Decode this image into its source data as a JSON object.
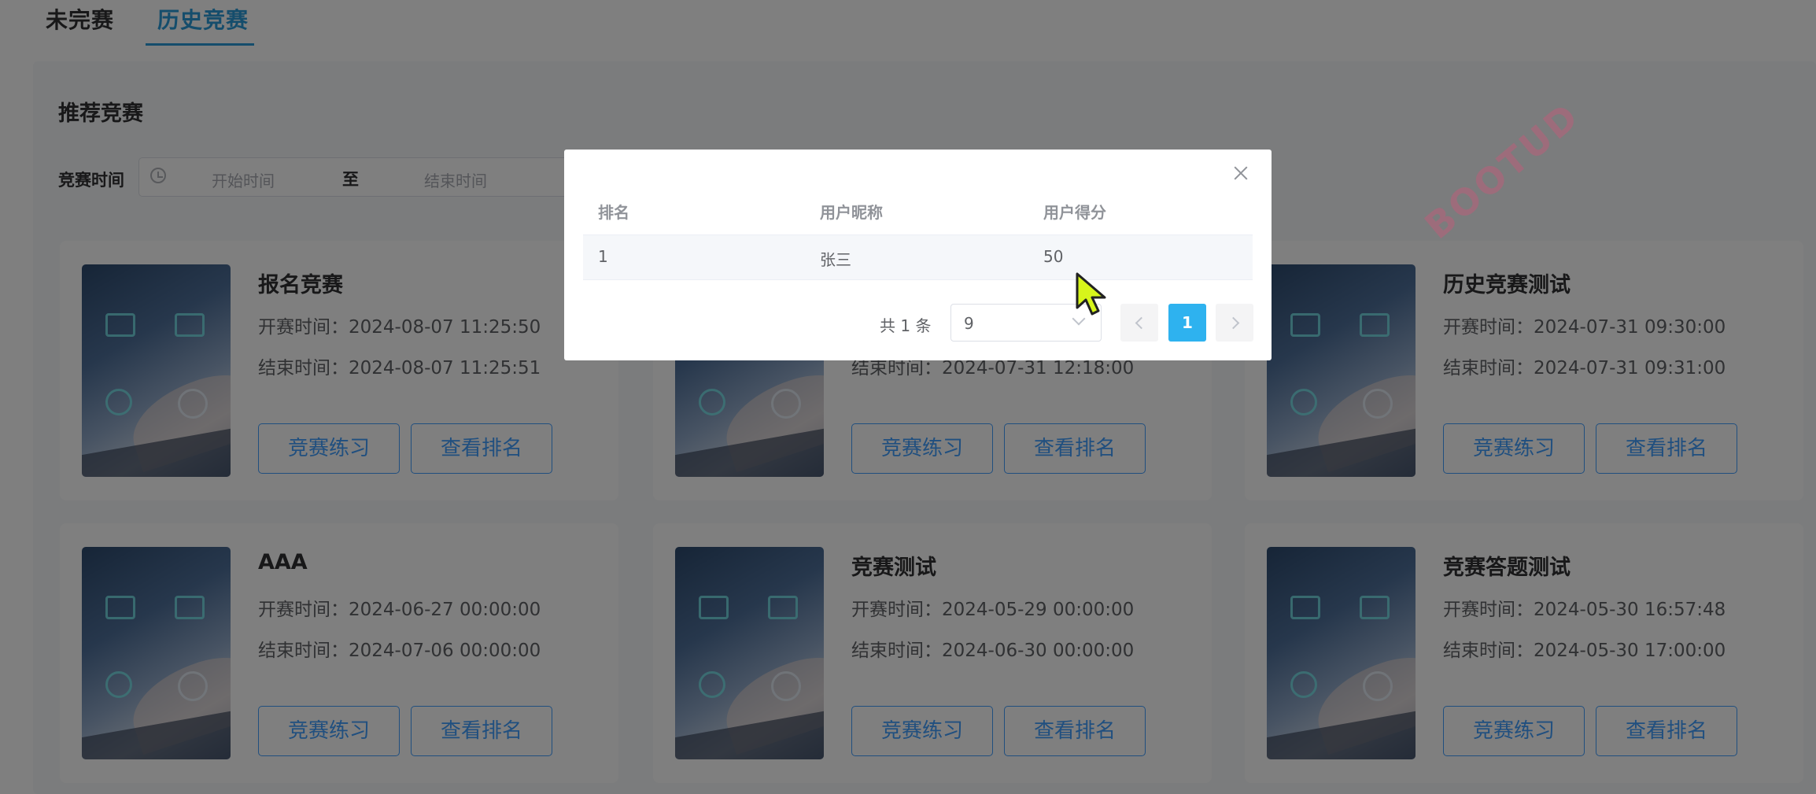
{
  "tabs": [
    {
      "label": "未完赛"
    },
    {
      "label": "历史竞赛"
    }
  ],
  "section_title": "推荐竞赛",
  "filter": {
    "label": "竞赛时间",
    "start_placeholder": "开始时间",
    "separator": "至",
    "end_placeholder": "结束时间"
  },
  "cards": [
    {
      "title": "报名竞赛",
      "start": "开赛时间：2024-08-07 11:25:50",
      "end": "结束时间：2024-08-07 11:25:51",
      "practice_label": "竞赛练习",
      "rank_label": "查看排名"
    },
    {
      "title": "",
      "start": "",
      "end": "结束时间：2024-07-31 12:18:00",
      "practice_label": "竞赛练习",
      "rank_label": "查看排名"
    },
    {
      "title": "历史竞赛测试",
      "start": "开赛时间：2024-07-31 09:30:00",
      "end": "结束时间：2024-07-31 09:31:00",
      "practice_label": "竞赛练习",
      "rank_label": "查看排名"
    },
    {
      "title": "AAA",
      "start": "开赛时间：2024-06-27 00:00:00",
      "end": "结束时间：2024-07-06 00:00:00",
      "practice_label": "竞赛练习",
      "rank_label": "查看排名"
    },
    {
      "title": "竞赛测试",
      "start": "开赛时间：2024-05-29 00:00:00",
      "end": "结束时间：2024-06-30 00:00:00",
      "practice_label": "竞赛练习",
      "rank_label": "查看排名"
    },
    {
      "title": "竞赛答题测试",
      "start": "开赛时间：2024-05-30 16:57:48",
      "end": "结束时间：2024-05-30 17:00:00",
      "practice_label": "竞赛练习",
      "rank_label": "查看排名"
    }
  ],
  "watermark": "BOOTUD",
  "dialog": {
    "columns": [
      "排名",
      "用户昵称",
      "用户得分"
    ],
    "rows": [
      [
        "1",
        "张三",
        "50"
      ]
    ],
    "pagination": {
      "total_text": "共 1 条",
      "page_size": "9",
      "current_page": "1"
    }
  }
}
